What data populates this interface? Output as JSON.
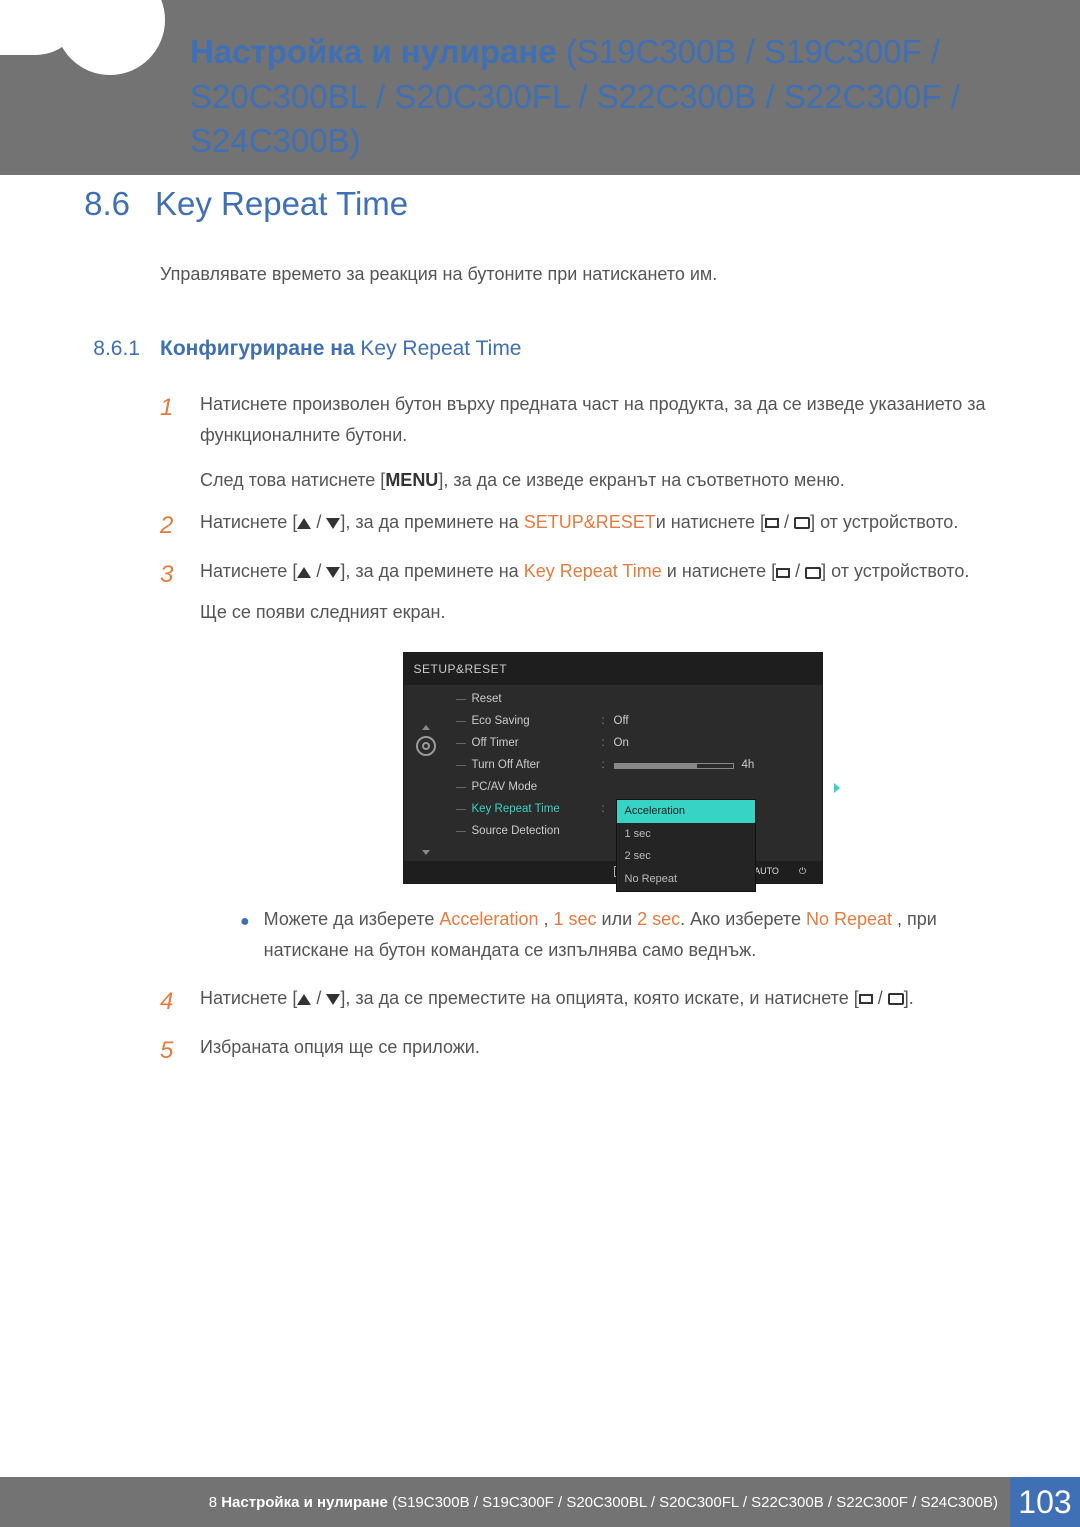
{
  "header": {
    "prefix_bold": "Настройка и нулиране",
    "models": " (S19C300B / S19C300F / S20C300BL / S20C300FL / S22C300B / S22C300F / S24C300B)"
  },
  "section": {
    "num": "8.6",
    "title": "Key Repeat Time"
  },
  "intro": "Управлявате времето за реакция на бутоните при натискането им.",
  "subsection": {
    "num": "8.6.1",
    "title_bold": "Конфигуриране на ",
    "title_rest": "Key Repeat Time"
  },
  "steps": {
    "s1a": "Натиснете произволен бутон върху предната част на продукта, за да се изведе указанието за функционалните бутони.",
    "s1b_pre": "След това натиснете [",
    "s1b_menu": "MENU",
    "s1b_post": "], за да се изведе екранът на съответното меню.",
    "s2_pre": "Натиснете [",
    "s2_mid1": "], за да преминете на ",
    "s2_setup": "SETUP&RESET",
    "s2_mid2": "и натиснете [",
    "s2_end": "] от устройството.",
    "s3_pre": "Натиснете [",
    "s3_mid1": "], за да преминете на ",
    "s3_krt": "Key Repeat Time",
    "s3_mid2": " и натиснете [",
    "s3_end": "] от устройството.",
    "s3_line2": "Ще се появи следният екран.",
    "bullet_pre": "Можете да изберете ",
    "bullet_acc": "Acceleration",
    "bullet_c1": " , ",
    "bullet_1s": "1 sec",
    "bullet_or": " или ",
    "bullet_2s": "2 sec",
    "bullet_if": ". Ако изберете ",
    "bullet_nr": "No Repeat",
    "bullet_post": " , при натискане на бутон командата се изпълнява само веднъж.",
    "s4_pre": "Натиснете [",
    "s4_mid": "], за да се преместите на опцията, която искате, и натиснете [",
    "s4_end": "].",
    "s5": "Избраната опция ще се приложи."
  },
  "osd": {
    "title": "SETUP&RESET",
    "items": {
      "reset": "Reset",
      "eco": "Eco Saving",
      "eco_val": "Off",
      "offtimer": "Off Timer",
      "offtimer_val": "On",
      "turnoff": "Turn Off After",
      "turnoff_val": "4h",
      "pcav": "PC/AV Mode",
      "krt": "Key Repeat Time",
      "srcdet": "Source Detection"
    },
    "popup": {
      "acc": "Acceleration",
      "s1": "1 sec",
      "s2": "2 sec",
      "nr": "No Repeat"
    },
    "footer": {
      "auto": "AUTO"
    }
  },
  "footer": {
    "chapter_num": "8 ",
    "chapter_bold": "Настройка и нулиране",
    "chapter_rest": " (S19C300B / S19C300F / S20C300BL / S20C300FL / S22C300B / S22C300F / S24C300B)",
    "page": "103"
  }
}
